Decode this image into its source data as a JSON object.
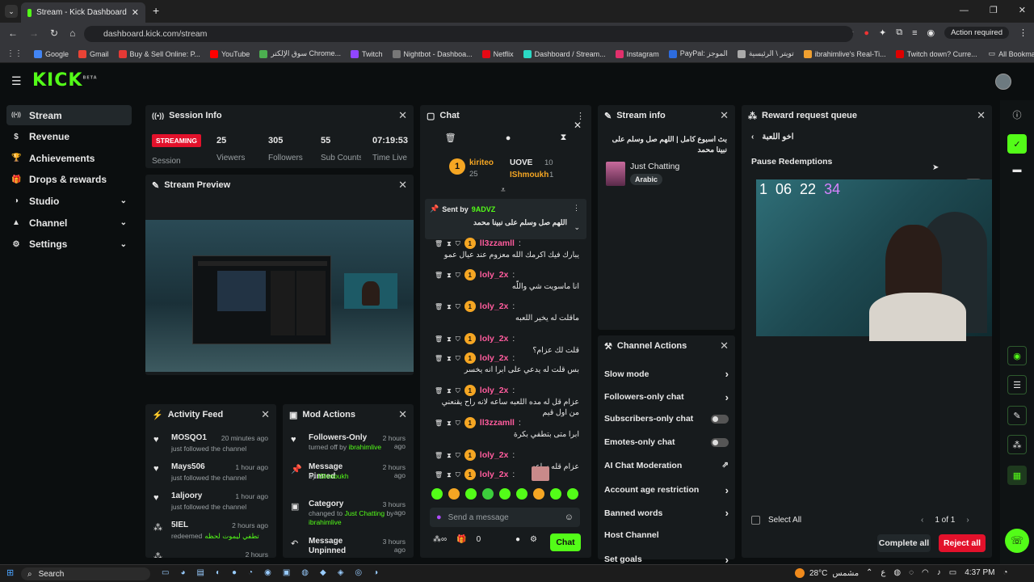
{
  "browser": {
    "tab_title": "Stream - Kick Dashboard",
    "url": "dashboard.kick.com/stream",
    "action_required": "Action required",
    "bookmarks": [
      {
        "label": "Google",
        "color": "#4285f4"
      },
      {
        "label": "Gmail",
        "color": "#ea4335"
      },
      {
        "label": "Buy & Sell Online: P...",
        "color": "#e53935"
      },
      {
        "label": "YouTube",
        "color": "#ff0000"
      },
      {
        "label": "سوق الإلكتر Chrome...",
        "color": "#4caf50"
      },
      {
        "label": "Twitch",
        "color": "#9146ff"
      },
      {
        "label": "Nightbot - Dashboa...",
        "color": "#777"
      },
      {
        "label": "Netflix",
        "color": "#e50914"
      },
      {
        "label": "Dashboard / Stream...",
        "color": "#2bd9c5"
      },
      {
        "label": "Instagram",
        "color": "#e1306c"
      },
      {
        "label": "PayPal: الموجز",
        "color": "#2d6cdf"
      },
      {
        "label": "تويتر \\ الرئيسية",
        "color": "#aaa"
      },
      {
        "label": "ibrahimlive's Real-Ti...",
        "color": "#f0a030"
      },
      {
        "label": "Twitch down? Curre...",
        "color": "#d00"
      }
    ],
    "all_bookmarks": "All Bookmarks"
  },
  "nav": {
    "items": [
      {
        "label": "Stream",
        "icon": "broadcast-icon",
        "active": true,
        "expand": false
      },
      {
        "label": "Revenue",
        "icon": "revenue-icon",
        "active": false,
        "expand": false
      },
      {
        "label": "Achievements",
        "icon": "trophy-icon",
        "active": false,
        "expand": false
      },
      {
        "label": "Drops & rewards",
        "icon": "gift-icon",
        "active": false,
        "expand": false
      },
      {
        "label": "Studio",
        "icon": "studio-icon",
        "active": false,
        "expand": true
      },
      {
        "label": "Channel",
        "icon": "channel-icon",
        "active": false,
        "expand": true
      },
      {
        "label": "Settings",
        "icon": "gear-icon",
        "active": false,
        "expand": true
      }
    ]
  },
  "session": {
    "title": "Session Info",
    "status": "STREAMING",
    "status_label": "Session",
    "stats": [
      {
        "value": "25",
        "label": "Viewers"
      },
      {
        "value": "305",
        "label": "Followers"
      },
      {
        "value": "55",
        "label": "Sub Counts"
      },
      {
        "value": "07:19:53",
        "label": "Time Live"
      }
    ]
  },
  "preview": {
    "title": "Stream Preview"
  },
  "activity": {
    "title": "Activity Feed",
    "items": [
      {
        "user": "MOSQO1",
        "time": "20 minutes ago",
        "desc": "just followed the channel",
        "icon": "heart-icon"
      },
      {
        "user": "Mays506",
        "time": "1 hour ago",
        "desc": "just followed the channel",
        "icon": "heart-icon"
      },
      {
        "user": "1aljoory",
        "time": "1 hour ago",
        "desc": "just followed the channel",
        "icon": "heart-icon"
      },
      {
        "user": "5IEL",
        "time": "2 hours ago",
        "desc": "redeemed",
        "extra": "تطفي ليموت لحظه",
        "icon": "redeem-icon"
      },
      {
        "user": "",
        "time": "2 hours",
        "desc": "",
        "icon": "redeem-icon"
      }
    ]
  },
  "mod": {
    "title": "Mod Actions",
    "items": [
      {
        "action": "Followers-Only",
        "time": "2 hours ago",
        "desc": "turned off by",
        "by": "ibrahimlive"
      },
      {
        "action": "Message Pinned",
        "time": "2 hours ago",
        "desc": "by",
        "by": "IShmoukh"
      },
      {
        "action": "Category",
        "time": "3 hours ago",
        "desc": "changed to",
        "by": "Just Chatting",
        "desc2": "by",
        "by2": "ibrahimlive"
      },
      {
        "action": "Message Unpinned",
        "time": "3 hours ago",
        "desc": "",
        "by": ""
      }
    ]
  },
  "chat": {
    "title": "Chat",
    "leaderboard": [
      {
        "name": "kiriteo",
        "count": "25",
        "rank": "1"
      },
      {
        "name": "UOVE",
        "count": "10"
      },
      {
        "name": "IShmoukh",
        "count": "1"
      }
    ],
    "pinned_label": "Sent by",
    "pinned_user": "9ADVZ",
    "pinned_text": "اللهم صل وسلم على نبينا محمد",
    "messages": [
      {
        "user": "ll3zzamll",
        "text": "يبارك فيك اكرمك الله معزوم عند عيال عمو"
      },
      {
        "user": "loly_2x",
        "text": "انا ماسويت شي واللّه"
      },
      {
        "user": "loly_2x",
        "text": "ماقلت له يخير اللعبه"
      },
      {
        "user": "loly_2x",
        "text": "قلت لك عزام؟"
      },
      {
        "user": "loly_2x",
        "text": "بس قلت له يدعي على ابرا انه يخسر"
      },
      {
        "user": "loly_2x",
        "text": "عزام قل له مده اللعبه ساعه لانه راح يقنعني من اول قيم"
      },
      {
        "user": "ll3zzamll",
        "text": "ابرا متى بتطفي بكرة"
      },
      {
        "user": "loly_2x",
        "text": "عزام قله ساعه"
      },
      {
        "user": "loly_2x",
        "text": ""
      }
    ],
    "placeholder": "Send a message",
    "send": "Chat",
    "count": "0"
  },
  "streaminfo": {
    "title": "Stream info",
    "stream_title": "بث اسبوع كامل | اللهم صل وسلم على نبينا محمد",
    "category": "Just Chatting",
    "tag": "Arabic"
  },
  "actions": {
    "title": "Channel Actions",
    "items": [
      {
        "label": "Slow mode",
        "kind": "chevron"
      },
      {
        "label": "Followers-only chat",
        "kind": "chevron"
      },
      {
        "label": "Subscribers-only chat",
        "kind": "toggle"
      },
      {
        "label": "Emotes-only chat",
        "kind": "toggle"
      },
      {
        "label": "AI Chat Moderation",
        "kind": "external"
      },
      {
        "label": "Account age restriction",
        "kind": "chevron"
      },
      {
        "label": "Banned words",
        "kind": "chevron"
      },
      {
        "label": "Host Channel",
        "kind": "none"
      },
      {
        "label": "Set goals",
        "kind": "chevron"
      }
    ]
  },
  "rewards": {
    "title": "Reward request queue",
    "back_label": "اخو اللعبة",
    "pause": "Pause Redemptions",
    "overlay_digits": [
      "1",
      "06",
      "22",
      "34"
    ],
    "select_all": "Select All",
    "pager": "1 of 1",
    "complete": "Complete all",
    "reject": "Reject all"
  },
  "taskbar": {
    "search": "Search",
    "weather": "28°C",
    "weather_desc": "مشمس",
    "time": "4:37 PM",
    "lang": "ع"
  },
  "colors": {
    "accent": "#53fc18",
    "streaming": "#e3112b",
    "reject": "#e3112b"
  }
}
